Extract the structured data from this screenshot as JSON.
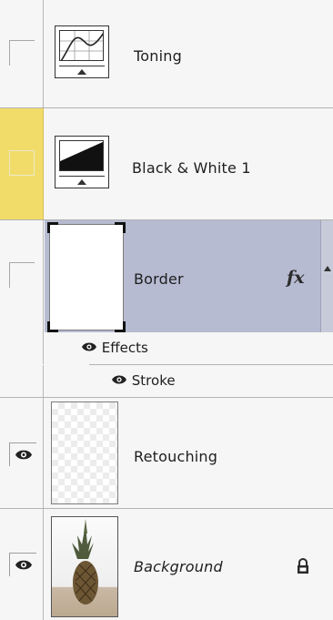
{
  "layers": [
    {
      "label": "Toning",
      "visible": false,
      "thumbnail": "curves-adjustment-icon"
    },
    {
      "label": "Black & White 1",
      "visible": false,
      "thumbnail": "black-white-adjustment-icon",
      "highlight_color": "#f1dc6a"
    },
    {
      "label": "Border",
      "visible": false,
      "selected": true,
      "thumbnail": "white-border-thumbnail",
      "fx_label": "fx"
    },
    {
      "label": "Retouching",
      "visible": true,
      "thumbnail": "transparent-checker-thumbnail"
    },
    {
      "label": "Background",
      "visible": true,
      "italic": true,
      "thumbnail": "pineapple-photo-thumbnail",
      "locked": true
    }
  ],
  "effects": {
    "label": "Effects",
    "items": [
      {
        "label": "Stroke"
      }
    ]
  },
  "colors": {
    "selection": "#b6bbd2",
    "highlight": "#f1dc6a",
    "panel": "#f6f6f6"
  }
}
